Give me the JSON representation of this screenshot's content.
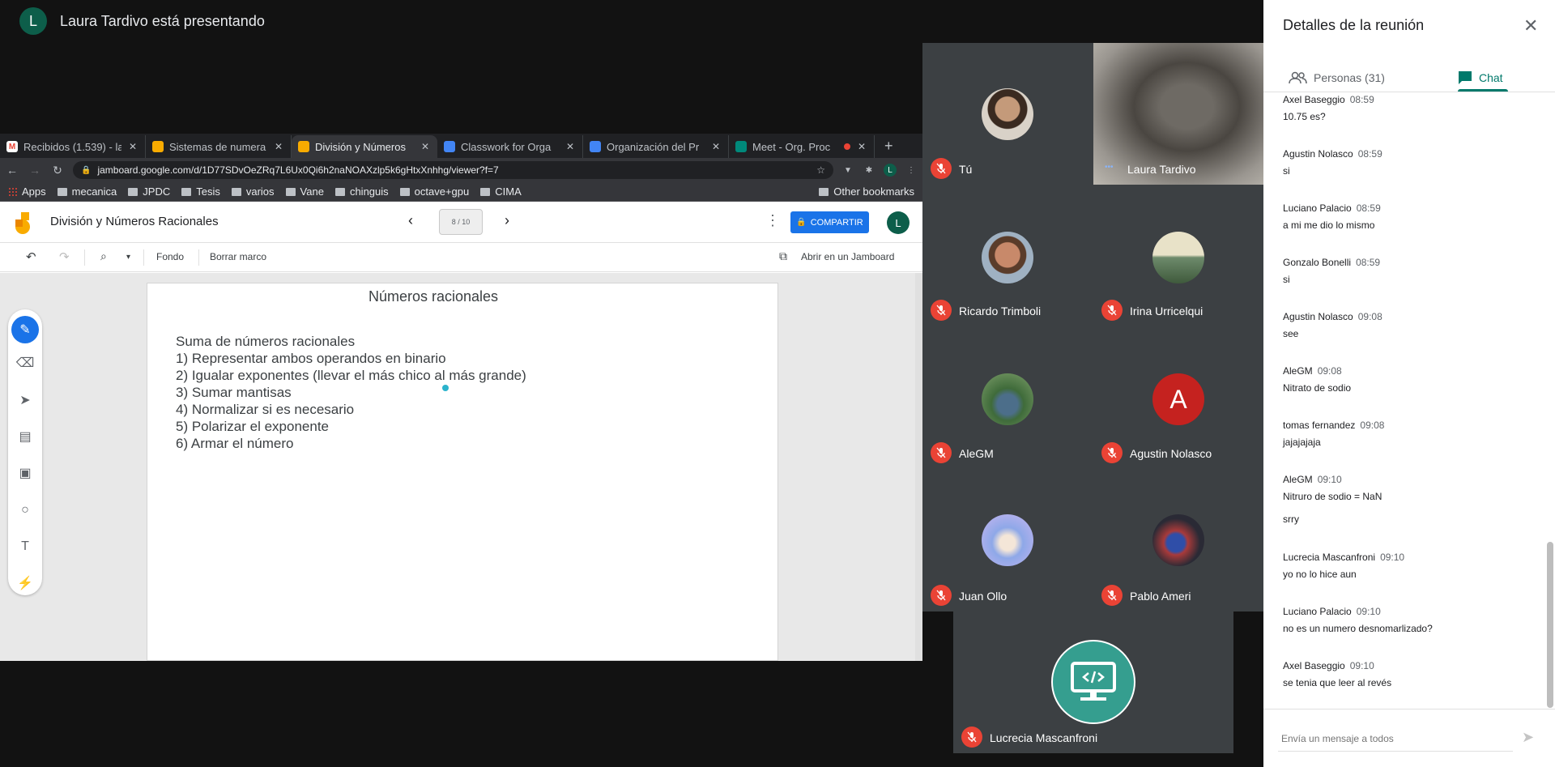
{
  "meeting": {
    "presenter_initial": "L",
    "presenter_status": "Laura Tardivo está presentando"
  },
  "browser": {
    "tabs": [
      {
        "title": "Recibidos (1.539) - la",
        "favicon": "gmail-icon",
        "color": "#ea4335"
      },
      {
        "title": "Sistemas de numera",
        "favicon": "jamboard-icon",
        "color": "#f9ab00"
      },
      {
        "title": "División y Números",
        "favicon": "jamboard-icon",
        "color": "#f9ab00"
      },
      {
        "title": "Classwork for Orga",
        "favicon": "classroom-icon",
        "color": "#4285f4"
      },
      {
        "title": "Organización del Pr",
        "favicon": "classroom-icon",
        "color": "#4285f4"
      },
      {
        "title": "Meet - Org. Proc",
        "favicon": "meet-icon",
        "color": "#00897b"
      }
    ],
    "new_tab": "+",
    "url": "jamboard.google.com/d/1D77SDvOeZRq7L6Ux0Qi6h2naNOAXzlp5k6gHtxXnhhg/viewer?f=7",
    "bookmarks": [
      "Apps",
      "mecanica",
      "JPDC",
      "Tesis",
      "varios",
      "Vane",
      "chinguis",
      "octave+gpu",
      "CIMA"
    ],
    "other_bookmarks": "Other bookmarks",
    "profile_initial": "L"
  },
  "jamboard": {
    "title": "División y Números Racionales",
    "frame_counter": "8 / 10",
    "share_label": "COMPARTIR",
    "user_initial": "L",
    "toolbar": {
      "zoom_caret": "▾",
      "background_label": "Fondo",
      "clear_label": "Borrar marco",
      "open_label": "Abrir en un Jamboard"
    },
    "frame": {
      "heading": "Números racionales",
      "subtitle": "Suma de números racionales",
      "lines": [
        "1) Representar ambos operandos en binario",
        "2) Igualar exponentes (llevar el más chico al más grande)",
        "3) Sumar mantisas",
        "4) Normalizar si es necesario",
        "5) Polarizar el exponente",
        "6) Armar el número"
      ]
    },
    "tools": [
      "pen-icon",
      "eraser-icon",
      "select-icon",
      "sticky-note-icon",
      "image-icon",
      "circle-icon",
      "text-box-icon",
      "laser-icon"
    ]
  },
  "participants": [
    {
      "name": "Tú"
    },
    {
      "name": "Laura Tardivo"
    },
    {
      "name": "Ricardo Trimboli"
    },
    {
      "name": "Irina Urricelqui"
    },
    {
      "name": "AleGM"
    },
    {
      "name": "Agustin Nolasco",
      "initial": "A"
    },
    {
      "name": "Juan Ollo"
    },
    {
      "name": "Pablo Ameri"
    },
    {
      "name": "Lucrecia Mascanfroni"
    }
  ],
  "panel": {
    "title": "Detalles de la reunión",
    "tab_people": "Personas (31)",
    "tab_chat": "Chat",
    "messages": [
      {
        "sender": "Axel Baseggio",
        "time": "08:59",
        "text": "10.75 es?"
      },
      {
        "sender": "Agustin Nolasco",
        "time": "08:59",
        "text": "si"
      },
      {
        "sender": "Luciano Palacio",
        "time": "08:59",
        "text": "a mi me dio lo mismo"
      },
      {
        "sender": "Gonzalo Bonelli",
        "time": "08:59",
        "text": "si"
      },
      {
        "sender": "Agustin Nolasco",
        "time": "09:08",
        "text": "see"
      },
      {
        "sender": "AleGM",
        "time": "09:08",
        "text": "Nitrato de sodio"
      },
      {
        "sender": "tomas fernandez",
        "time": "09:08",
        "text": "jajajajaja"
      },
      {
        "sender": "AleGM",
        "time": "09:10",
        "text": "Nitruro de sodio = NaN",
        "text2": "srry"
      },
      {
        "sender": "Lucrecia Mascanfroni",
        "time": "09:10",
        "text": "yo no lo hice aun"
      },
      {
        "sender": "Luciano Palacio",
        "time": "09:10",
        "text": "no es un numero desnomarlizado?"
      },
      {
        "sender": "Axel Baseggio",
        "time": "09:10",
        "text": "se tenia que leer al revés"
      }
    ],
    "input_placeholder": "Envía un mensaje a todos"
  }
}
